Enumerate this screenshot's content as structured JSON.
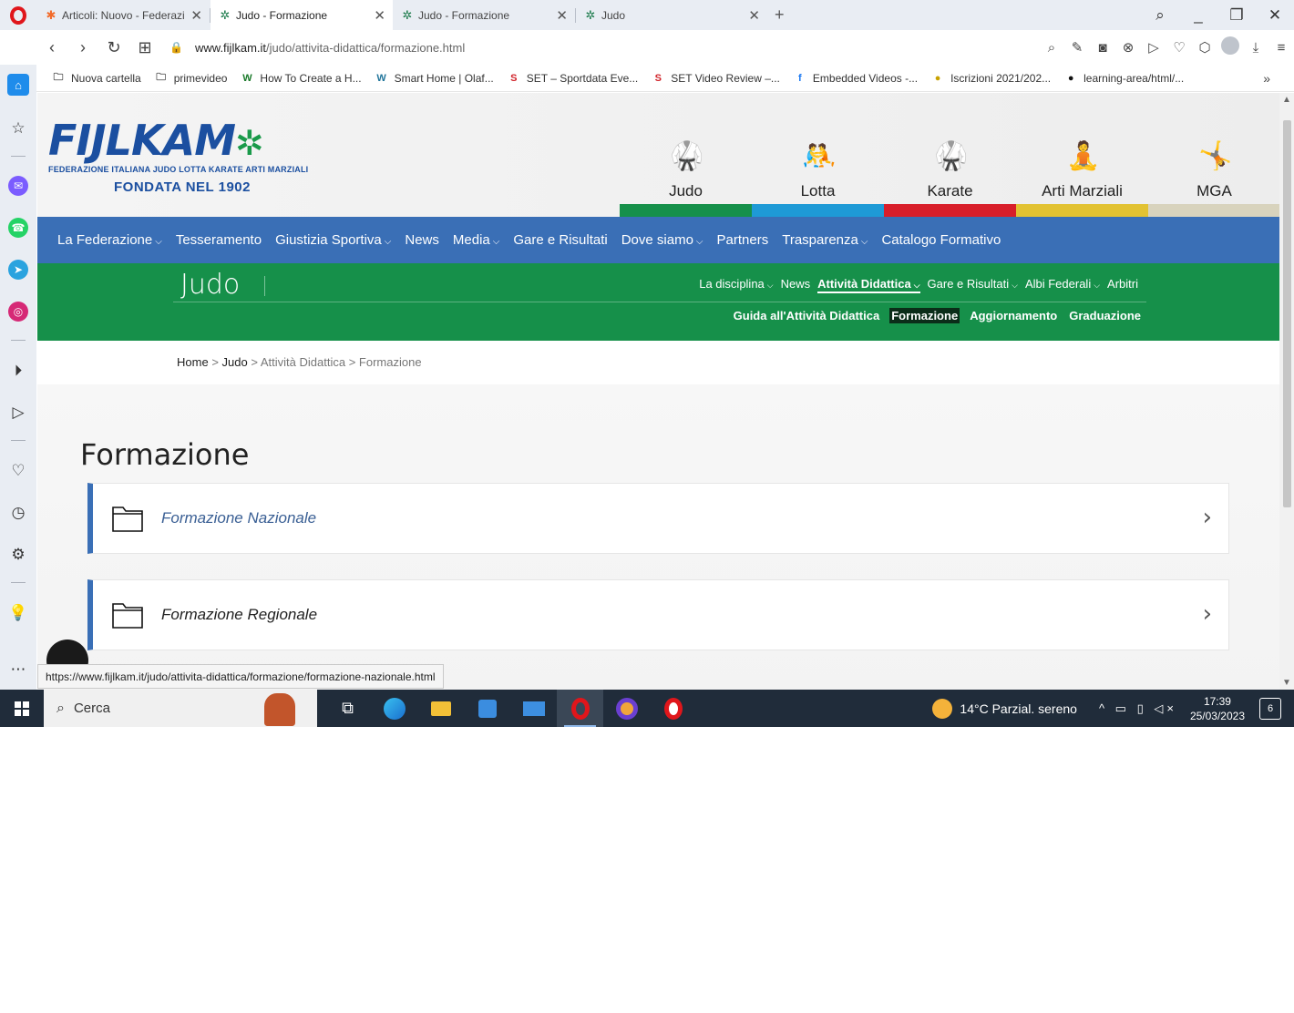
{
  "browser": {
    "tabs": [
      {
        "title": "Articoli: Nuovo - Federazio",
        "active": false,
        "favicon": "joomla-icon",
        "close": "✕"
      },
      {
        "title": "Judo - Formazione",
        "active": true,
        "favicon": "fijlkam-icon",
        "close": "✕"
      },
      {
        "title": "Judo - Formazione",
        "active": false,
        "favicon": "fijlkam-icon",
        "close": "✕"
      },
      {
        "title": "Judo",
        "active": false,
        "favicon": "fijlkam-icon",
        "close": "✕"
      }
    ],
    "new_tab": "+",
    "url_host": "www.fijlkam.it",
    "url_path": "/judo/attivita-didattica/formazione.html",
    "bookmarks": [
      {
        "label": "Nuova cartella",
        "icon": "folder-icon",
        "glyph": "🗀",
        "color": "#444444"
      },
      {
        "label": "primevideo",
        "icon": "folder-icon",
        "glyph": "🗀",
        "color": "#444444"
      },
      {
        "label": "How To Create a H...",
        "icon": "w-logo-icon",
        "glyph": "W",
        "color": "#1a7a2a"
      },
      {
        "label": "Smart Home | Olaf...",
        "icon": "wordpress-icon",
        "glyph": "W",
        "color": "#21759b"
      },
      {
        "label": "SET – Sportdata Eve...",
        "icon": "set-icon",
        "glyph": "S",
        "color": "#d1232a"
      },
      {
        "label": "SET Video Review –...",
        "icon": "set-icon",
        "glyph": "S",
        "color": "#d1232a"
      },
      {
        "label": "Embedded Videos -...",
        "icon": "facebook-icon",
        "glyph": "f",
        "color": "#1877f2"
      },
      {
        "label": "Iscrizioni 2021/202...",
        "icon": "badge-icon",
        "glyph": "●",
        "color": "#c8a200"
      },
      {
        "label": "learning-area/html/...",
        "icon": "github-icon",
        "glyph": "●",
        "color": "#111111"
      }
    ],
    "bookmarks_more": "»",
    "status_url": "https://www.fijlkam.it/judo/attivita-didattica/formazione/formazione-nazionale.html"
  },
  "site": {
    "logo_text": "FIJLKAM",
    "logo_subtitle": "FEDERAZIONE ITALIANA JUDO LOTTA KARATE ARTI MARZIALI",
    "logo_since": "FONDATA NEL 1902",
    "disciplines": [
      {
        "label": "Judo",
        "color": "#16904a",
        "icon": "judo-icon"
      },
      {
        "label": "Lotta",
        "color": "#1e9ad6",
        "icon": "wrestling-icon"
      },
      {
        "label": "Karate",
        "color": "#d81e2a",
        "icon": "karate-icon"
      },
      {
        "label": "Arti Marziali",
        "color": "#e2c232",
        "icon": "martial-arts-icon"
      },
      {
        "label": "MGA",
        "color": "#d8d3bd",
        "icon": "mga-icon"
      }
    ],
    "main_nav": [
      {
        "label": "La Federazione",
        "dropdown": true
      },
      {
        "label": "Tesseramento",
        "dropdown": false
      },
      {
        "label": "Giustizia Sportiva",
        "dropdown": true
      },
      {
        "label": "News",
        "dropdown": false
      },
      {
        "label": "Media",
        "dropdown": true
      },
      {
        "label": "Gare e Risultati",
        "dropdown": false
      },
      {
        "label": "Dove siamo",
        "dropdown": true
      },
      {
        "label": "Partners",
        "dropdown": false
      },
      {
        "label": "Trasparenza",
        "dropdown": true
      },
      {
        "label": "Catalogo Formativo",
        "dropdown": false
      }
    ],
    "section_title": "Judo",
    "section_nav": [
      {
        "label": "La disciplina",
        "dropdown": true,
        "active": false
      },
      {
        "label": "News",
        "dropdown": false,
        "active": false
      },
      {
        "label": "Attività Didattica",
        "dropdown": true,
        "active": true
      },
      {
        "label": "Gare e Risultati",
        "dropdown": true,
        "active": false
      },
      {
        "label": "Albi Federali",
        "dropdown": true,
        "active": false
      },
      {
        "label": "Arbitri",
        "dropdown": false,
        "active": false
      }
    ],
    "section_subnav": [
      {
        "label": "Guida all'Attività Didattica",
        "active": false
      },
      {
        "label": "Formazione",
        "active": true
      },
      {
        "label": "Aggiornamento",
        "active": false
      },
      {
        "label": "Graduazione",
        "active": false
      }
    ],
    "breadcrumb": {
      "home": "Home",
      "judo": "Judo",
      "attivita": "Attività Didattica",
      "current": "Formazione",
      "sep": ">"
    },
    "page_title": "Formazione",
    "cards": [
      {
        "label": "Formazione Nazionale",
        "hovered": true
      },
      {
        "label": "Formazione Regionale",
        "hovered": false
      }
    ]
  },
  "taskbar": {
    "search_label": "Cerca",
    "weather": "14°C  Parzial. sereno",
    "time": "17:39",
    "date": "25/03/2023",
    "notifications": "6"
  }
}
